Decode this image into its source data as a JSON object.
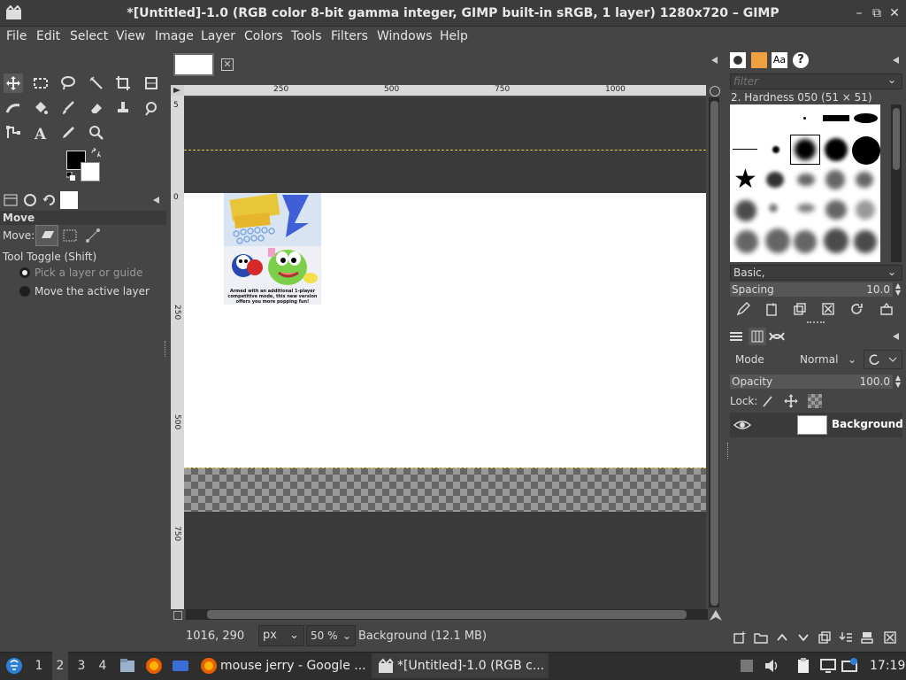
{
  "window": {
    "title": "*[Untitled]-1.0 (RGB color 8-bit gamma integer, GIMP built-in sRGB, 1 layer) 1280x720 – GIMP",
    "controls": [
      "–",
      "⧉",
      "✕"
    ]
  },
  "menu": [
    "File",
    "Edit",
    "Select",
    "View",
    "Image",
    "Layer",
    "Colors",
    "Tools",
    "Filters",
    "Windows",
    "Help"
  ],
  "tool_options": {
    "title": "Move",
    "move_label": "Move:",
    "toggle_label": "Tool Toggle  (Shift)",
    "option_pick": "Pick a layer or guide",
    "option_move": "Move the active layer"
  },
  "rulers": {
    "top": [
      "250",
      "500",
      "750",
      "1000"
    ],
    "left": [
      "0",
      "250",
      "500",
      "750"
    ],
    "left_first": "5"
  },
  "status": {
    "coords": "1016, 290",
    "unit": "px",
    "zoom": "50 %",
    "layer_info": "Background (12.1 MB)"
  },
  "brushes": {
    "filter_placeholder": "filter",
    "current": "2. Hardness 050 (51 × 51)",
    "preset": "Basic,",
    "spacing_label": "Spacing",
    "spacing_value": "10.0"
  },
  "layers": {
    "mode_label": "Mode",
    "mode_value": "Normal",
    "opacity_label": "Opacity",
    "opacity_value": "100.0",
    "lock_label": "Lock:",
    "layer_name": "Background"
  },
  "image_text": {
    "tagline": "Armed with an additional 1-player competitive mode, this new version offers you more popping fun!"
  },
  "taskbar": {
    "workspaces": [
      "1",
      "2",
      "3",
      "4"
    ],
    "active_workspace": "2",
    "task1": "mouse jerry - Google ...",
    "task2": "*[Untitled]-1.0 (RGB c...",
    "clock": "17:19"
  }
}
